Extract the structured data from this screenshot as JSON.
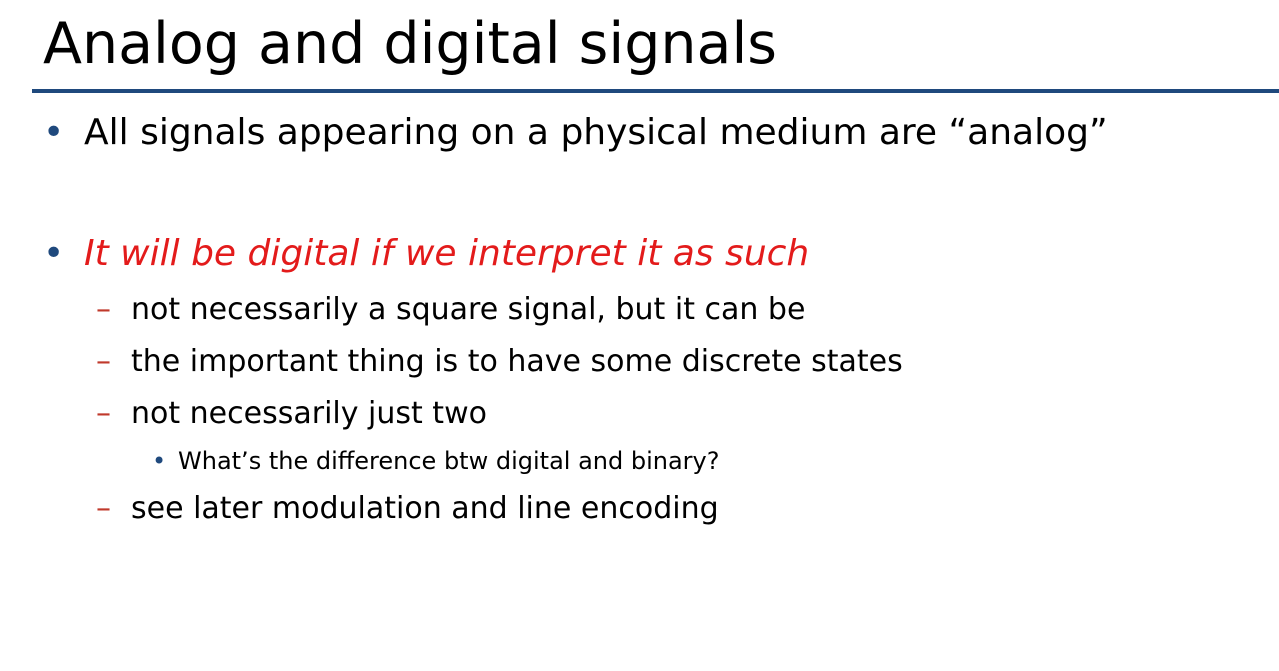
{
  "slide": {
    "title": "Analog and digital signals",
    "bullets": [
      {
        "marker": "•",
        "text": "All signals appearing on a physical medium are “analog”"
      },
      {
        "marker": "•",
        "text": "It will be digital if we interpret it as such"
      }
    ],
    "sub_bullets": [
      {
        "marker": "–",
        "text": "not necessarily a square signal, but it can be"
      },
      {
        "marker": "–",
        "text": "the important thing is to have some discrete states"
      },
      {
        "marker": "–",
        "text": "not necessarily just two"
      },
      {
        "marker": "–",
        "text": "see later modulation and line encoding"
      }
    ],
    "sub_sub_bullets": [
      {
        "marker": "•",
        "text": "What’s the difference btw digital and binary?"
      }
    ]
  },
  "colors": {
    "accent_rule": "#1f497d",
    "bullet_marker": "#1f497d",
    "dash_marker": "#c0392b",
    "emphasis_text": "#e31b1b"
  }
}
